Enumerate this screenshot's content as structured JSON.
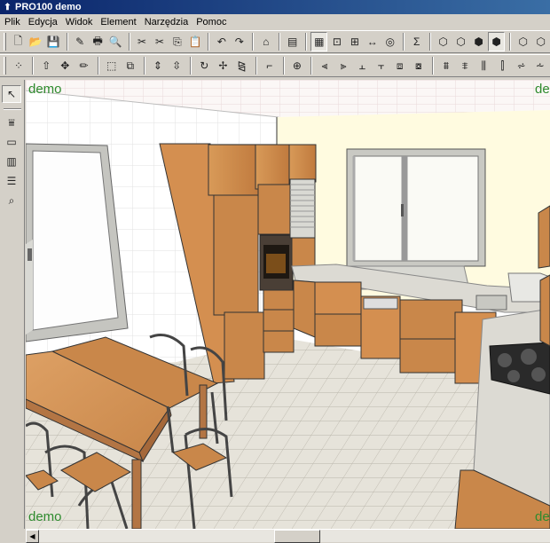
{
  "window": {
    "title": "PRO100 demo"
  },
  "menu": [
    "Plik",
    "Edycja",
    "Widok",
    "Element",
    "Narzędzia",
    "Pomoc"
  ],
  "toolbar1": [
    {
      "name": "new-icon",
      "glyph": "🗋"
    },
    {
      "name": "open-icon",
      "glyph": "📂"
    },
    {
      "name": "save-icon",
      "glyph": "💾"
    },
    {
      "name": "sep"
    },
    {
      "name": "properties-icon",
      "glyph": "✎"
    },
    {
      "name": "print-icon",
      "glyph": "🖶"
    },
    {
      "name": "print-preview-icon",
      "glyph": "🔍"
    },
    {
      "name": "sep"
    },
    {
      "name": "cut-icon",
      "glyph": "✂"
    },
    {
      "name": "cut2-icon",
      "glyph": "✂"
    },
    {
      "name": "copy-icon",
      "glyph": "⎘"
    },
    {
      "name": "paste-icon",
      "glyph": "📋"
    },
    {
      "name": "sep"
    },
    {
      "name": "undo-icon",
      "glyph": "↶"
    },
    {
      "name": "redo-icon",
      "glyph": "↷"
    },
    {
      "name": "sep"
    },
    {
      "name": "room-icon",
      "glyph": "⌂"
    },
    {
      "name": "sep"
    },
    {
      "name": "list-icon",
      "glyph": "▤"
    },
    {
      "name": "sep"
    },
    {
      "name": "view-plan-icon",
      "glyph": "▦",
      "pressed": true
    },
    {
      "name": "view-zoom-icon",
      "glyph": "⊡"
    },
    {
      "name": "view-walls-icon",
      "glyph": "⊞"
    },
    {
      "name": "dimension-icon",
      "glyph": "↔"
    },
    {
      "name": "render-icon",
      "glyph": "◎"
    },
    {
      "name": "sep"
    },
    {
      "name": "sum-icon",
      "glyph": "Σ"
    },
    {
      "name": "sep"
    },
    {
      "name": "cube-wire-icon",
      "glyph": "⬡"
    },
    {
      "name": "cube-outline-icon",
      "glyph": "⬡"
    },
    {
      "name": "cube-shaded-icon",
      "glyph": "⬢"
    },
    {
      "name": "cube-solid-icon",
      "glyph": "⬢",
      "pressed": true
    },
    {
      "name": "sep"
    },
    {
      "name": "cube-front-icon",
      "glyph": "⬡"
    },
    {
      "name": "cube-side-icon",
      "glyph": "⬡"
    }
  ],
  "toolbar2": [
    {
      "name": "grid-icon",
      "glyph": "⁘"
    },
    {
      "name": "sep"
    },
    {
      "name": "move-up-icon",
      "glyph": "⇧"
    },
    {
      "name": "move-free-icon",
      "glyph": "✥"
    },
    {
      "name": "pencil-icon",
      "glyph": "✏"
    },
    {
      "name": "sep"
    },
    {
      "name": "select-rect-icon",
      "glyph": "⬚"
    },
    {
      "name": "group-icon",
      "glyph": "⧉"
    },
    {
      "name": "sep"
    },
    {
      "name": "lift-icon",
      "glyph": "⇕"
    },
    {
      "name": "lower-icon",
      "glyph": "⇳"
    },
    {
      "name": "sep"
    },
    {
      "name": "rotate-icon",
      "glyph": "↻"
    },
    {
      "name": "move-icon",
      "glyph": "✢"
    },
    {
      "name": "mirror-icon",
      "glyph": "⧎"
    },
    {
      "name": "sep"
    },
    {
      "name": "align-corner-icon",
      "glyph": "⌐"
    },
    {
      "name": "sep"
    },
    {
      "name": "target-icon",
      "glyph": "⊕"
    },
    {
      "name": "sep"
    },
    {
      "name": "align-left-icon",
      "glyph": "⫷"
    },
    {
      "name": "align-right-icon",
      "glyph": "⫸"
    },
    {
      "name": "align-top-icon",
      "glyph": "⫠"
    },
    {
      "name": "align-bottom-icon",
      "glyph": "⫟"
    },
    {
      "name": "align-back-icon",
      "glyph": "⧈"
    },
    {
      "name": "align-front-icon",
      "glyph": "⧇"
    },
    {
      "name": "sep"
    },
    {
      "name": "distribute-h-icon",
      "glyph": "⩩"
    },
    {
      "name": "distribute-v-icon",
      "glyph": "⩨"
    },
    {
      "name": "distribute-d-icon",
      "glyph": "⫼"
    },
    {
      "name": "distribute-e-icon",
      "glyph": "⫿"
    },
    {
      "name": "distribute-f-icon",
      "glyph": "⩫"
    },
    {
      "name": "distribute-g-icon",
      "glyph": "⩪"
    }
  ],
  "lefttools": [
    {
      "name": "pointer-icon",
      "glyph": "↖",
      "pressed": true
    },
    {
      "name": "sep"
    },
    {
      "name": "wall-tool-icon",
      "glyph": "⩸"
    },
    {
      "name": "box-tool-icon",
      "glyph": "▭"
    },
    {
      "name": "cabinet-tool-icon",
      "glyph": "▥"
    },
    {
      "name": "shelf-tool-icon",
      "glyph": "☰"
    },
    {
      "name": "magnify-tool-icon",
      "glyph": "⌕"
    }
  ],
  "watermark": "demo",
  "colors": {
    "wood": "#c9874a",
    "wood_dark": "#a5683a",
    "wall_cream": "#fffbe0",
    "floor_tile": "#e4e2da",
    "countertop": "#dcdad3",
    "window_frame": "#bdbdb8",
    "watermark": "#2e8b2e"
  }
}
